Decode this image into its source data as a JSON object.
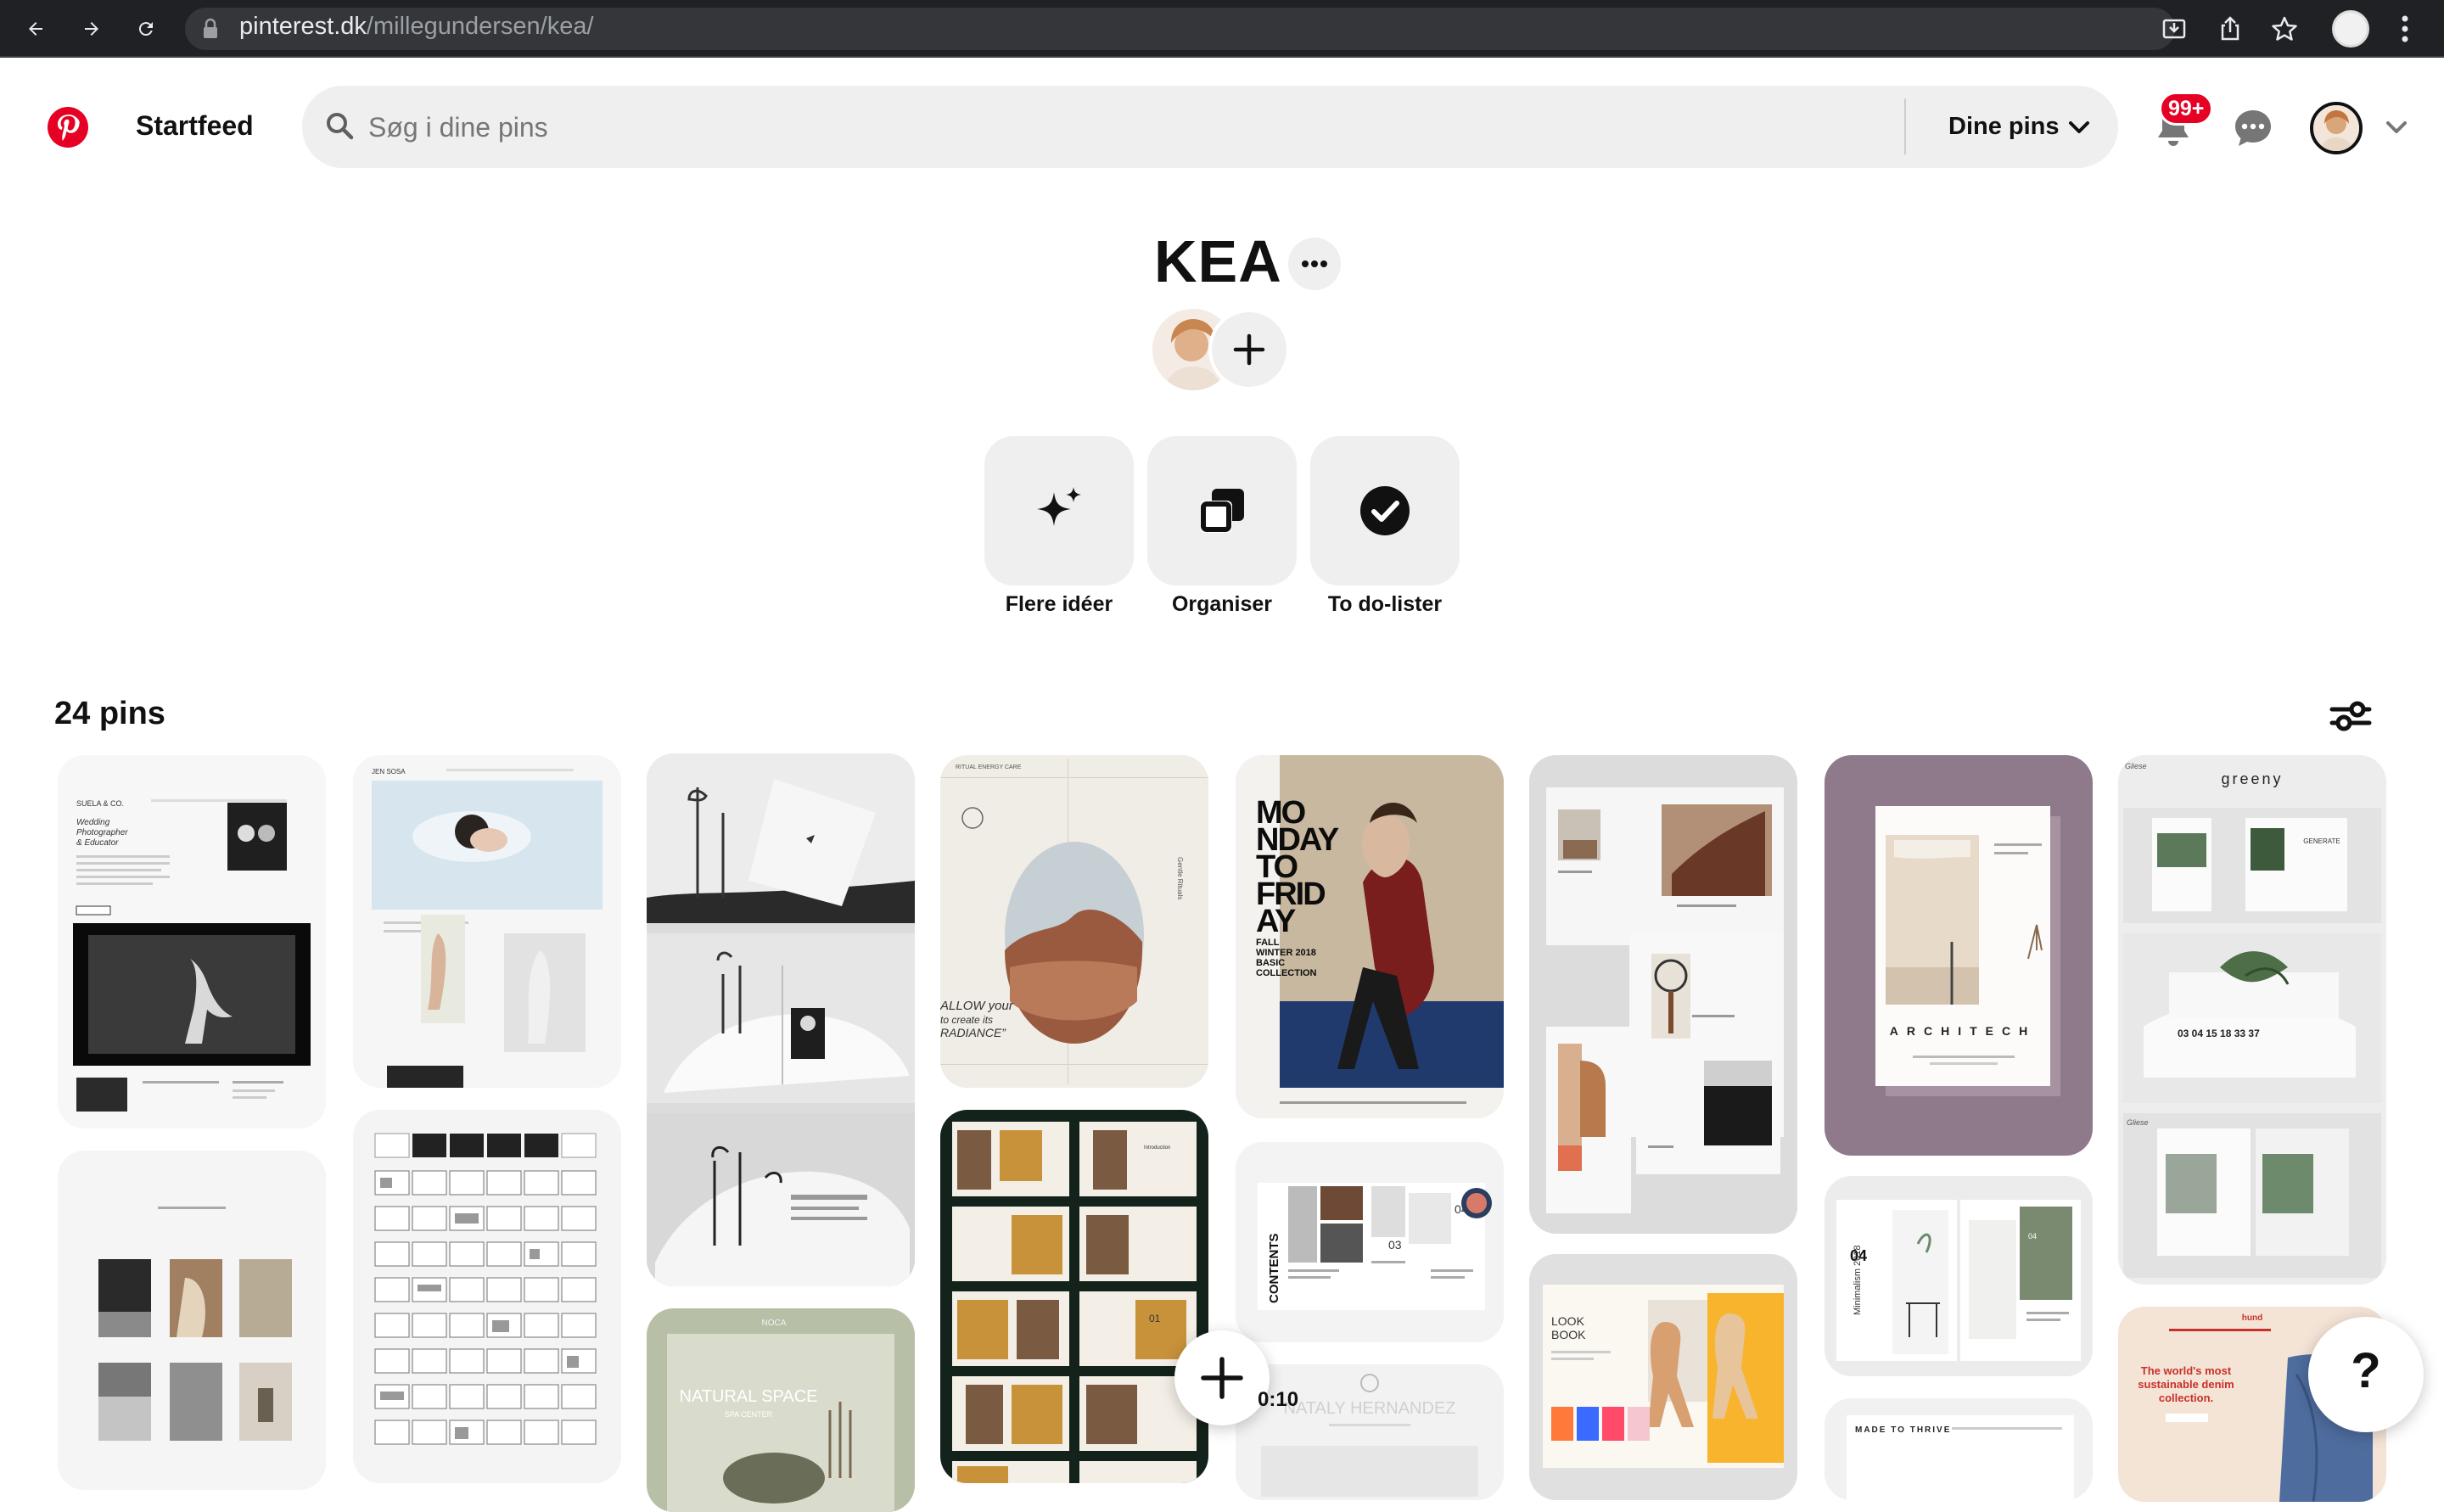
{
  "browser": {
    "url_host": "pinterest.dk",
    "url_path": "/millegundersen/kea/"
  },
  "header": {
    "home_label": "Startfeed",
    "search_placeholder": "Søg i dine pins",
    "search_value": "",
    "scope_label": "Dine pins",
    "notifications_badge": "99+"
  },
  "board": {
    "title": "KEA",
    "tools": [
      {
        "label": "Flere idéer",
        "icon": "sparkle-icon"
      },
      {
        "label": "Organiser",
        "icon": "organize-icon"
      },
      {
        "label": "To do-lister",
        "icon": "checkmark-icon"
      }
    ],
    "pin_count_label": "24 pins"
  },
  "pins": [
    {
      "col": 1,
      "headline": "Wedding Photographer & Educator",
      "brand": "SUELA & CO."
    },
    {
      "col": 1,
      "headline": "",
      "brand": ""
    },
    {
      "col": 2,
      "headline": "",
      "brand": "JEN SOSA"
    },
    {
      "col": 2,
      "headline": "",
      "brand": ""
    },
    {
      "col": 3,
      "headline": "",
      "brand": ""
    },
    {
      "col": 3,
      "headline": "NATURAL SPACE",
      "brand": "SPA CENTER"
    },
    {
      "col": 4,
      "headline": "ALLOW your to create its RADIANCE",
      "brand": "RITUAL ENERGY CARE"
    },
    {
      "col": 4,
      "headline": "",
      "brand": ""
    },
    {
      "col": 5,
      "headline": "MONDAY TO FRIDAY",
      "brand": "FALL WINTER 2018 BASIC COLLECTION"
    },
    {
      "col": 5,
      "headline": "CONTENTS",
      "brand": ""
    },
    {
      "col": 6,
      "headline": "",
      "brand": ""
    },
    {
      "col": 6,
      "headline": "LOOK BOOK",
      "brand": ""
    },
    {
      "col": 7,
      "headline": "ARCHITECH",
      "brand": ""
    },
    {
      "col": 7,
      "headline": "Minimalism 2018",
      "brand": ""
    },
    {
      "col": 7,
      "headline": "MADE TO THRIVE",
      "brand": ""
    },
    {
      "col": 8,
      "headline": "greeny",
      "brand": ""
    },
    {
      "col": 8,
      "headline": "The world's most sustainable denim collection.",
      "brand": "hund"
    }
  ],
  "video_time": "0:10",
  "help_label": "?",
  "colors": {
    "brand_red": "#e60023",
    "surface_gray": "#efefef",
    "text_primary": "#111111"
  }
}
